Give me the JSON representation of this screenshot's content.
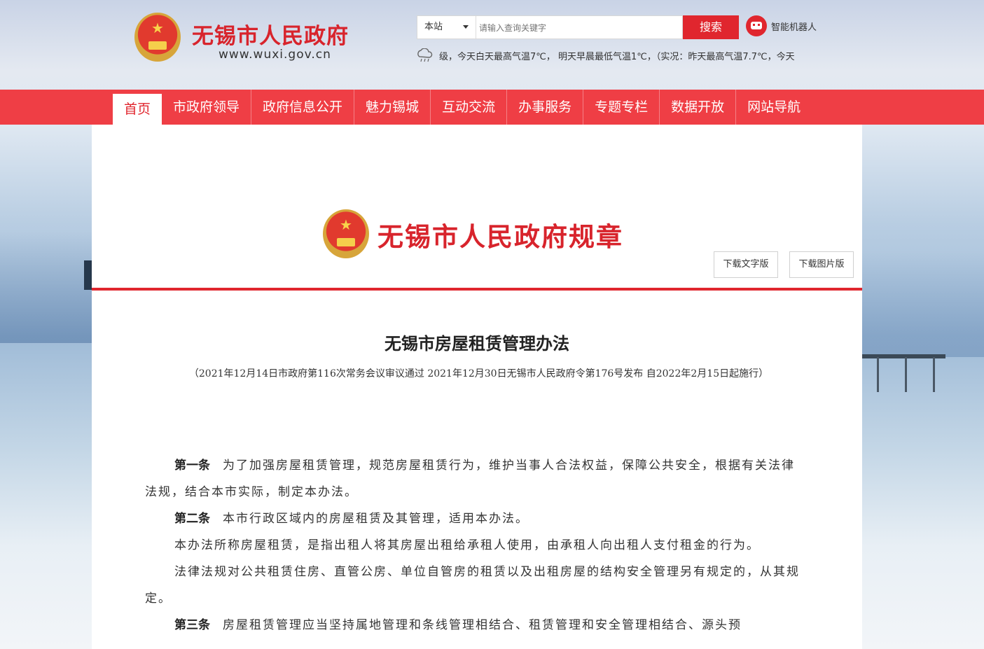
{
  "header": {
    "site_title": "无锡市人民政府",
    "site_url": "www.wuxi.gov.cn",
    "search_scope": "本站",
    "search_placeholder": "请输入查询关键字",
    "search_button": "搜索",
    "robot_label": "智能机器人",
    "weather_text": "级，今天白天最高气温7℃， 明天早晨最低气温1℃，（实况：昨天最高气温7.7℃，今天",
    "weather_icon": "cloud-rain-icon"
  },
  "nav": {
    "items": [
      "首页",
      "市政府领导",
      "政府信息公开",
      "魅力锡城",
      "互动交流",
      "办事服务",
      "专题专栏",
      "数据开放",
      "网站导航"
    ]
  },
  "banner": {
    "title": "无锡市人民政府规章",
    "download_text": "下载文字版",
    "download_image": "下载图片版"
  },
  "document": {
    "title": "无锡市房屋租赁管理办法",
    "subtitle": "（2021年12月14日市政府第116次常务会议审议通过 2021年12月30日无锡市人民政府令第176号发布 自2022年2月15日起施行）",
    "paragraphs": [
      {
        "article": "第一条",
        "text": "为了加强房屋租赁管理，规范房屋租赁行为，维护当事人合法权益，保障公共安全，根据有关法律法规，结合本市实际，制定本办法。"
      },
      {
        "article": "第二条",
        "text": "本市行政区域内的房屋租赁及其管理，适用本办法。"
      },
      {
        "article": "",
        "text": "本办法所称房屋租赁，是指出租人将其房屋出租给承租人使用，由承租人向出租人支付租金的行为。"
      },
      {
        "article": "",
        "text": "法律法规对公共租赁住房、直管公房、单位自管房的租赁以及出租房屋的结构安全管理另有规定的，从其规定。"
      },
      {
        "article": "第三条",
        "text": "房屋租赁管理应当坚持属地管理和条线管理相结合、租赁管理和安全管理相结合、源头预"
      }
    ]
  },
  "colors": {
    "brand_red": "#e0262e",
    "nav_red": "#ef3e45"
  }
}
